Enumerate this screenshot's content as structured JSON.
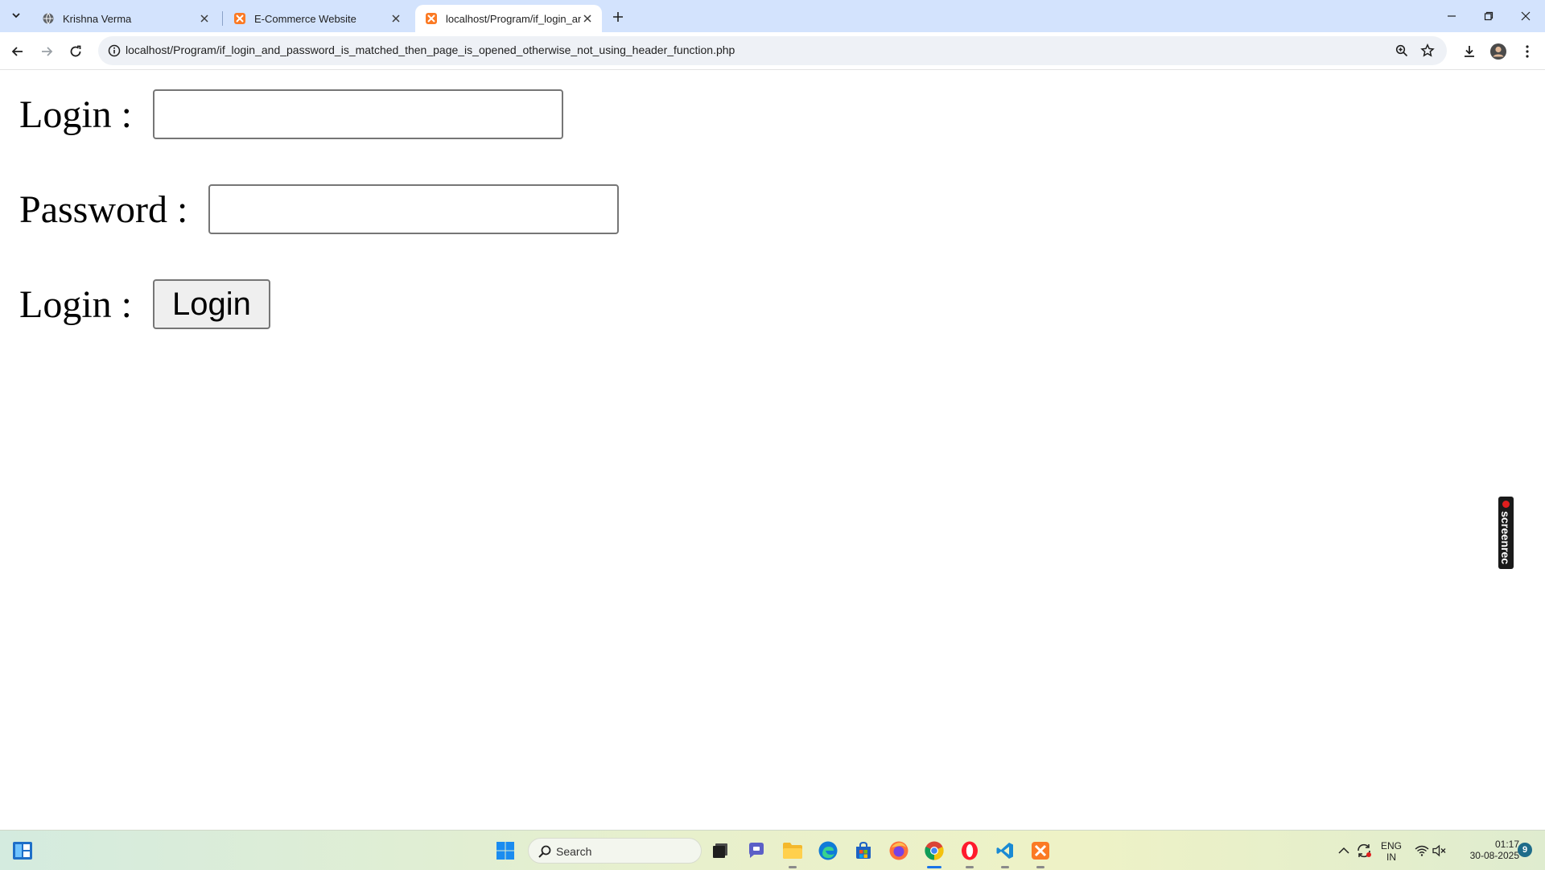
{
  "browser": {
    "tabs": [
      {
        "title": "Krishna Verma",
        "icon": "globe-icon",
        "active": false
      },
      {
        "title": "E-Commerce Website",
        "icon": "xampp-icon",
        "active": false
      },
      {
        "title": "localhost/Program/if_login_and",
        "icon": "xampp-icon",
        "active": true
      }
    ],
    "url": "localhost/Program/if_login_and_password_is_matched_then_page_is_opened_otherwise_not_using_header_function.php",
    "accent_color": "#d3e3fd"
  },
  "form": {
    "login_label": "Login : ",
    "login_value": "",
    "password_label": "Password : ",
    "password_value": "",
    "submit_row_label": "Login : ",
    "submit_label": "Login"
  },
  "overlay": {
    "screenrec_text": "screenrec"
  },
  "taskbar": {
    "search_placeholder": "Search",
    "language_line1": "ENG",
    "language_line2": "IN",
    "time": "01:17",
    "date": "30-08-2025",
    "notification_count": "9"
  }
}
